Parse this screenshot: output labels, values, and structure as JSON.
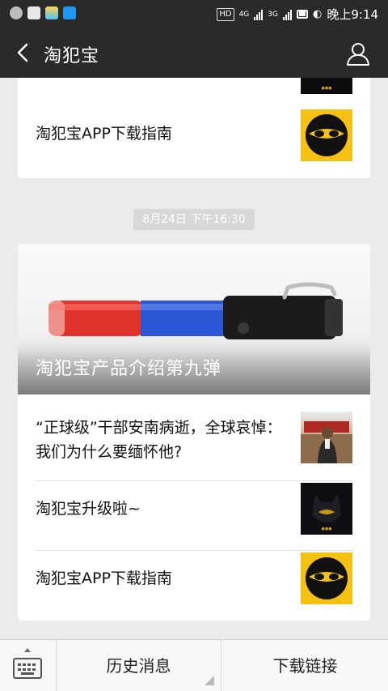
{
  "status_bar": {
    "time": "晚上9:14",
    "hd": "HD",
    "net1": "4G",
    "net2": "3G"
  },
  "header": {
    "title": "淘犯宝"
  },
  "card1": {
    "items": [
      {
        "title": "淘犯宝APP下载指南",
        "thumb": "ninja-mask-logo"
      }
    ]
  },
  "timestamp": "8月24日 下午16:30",
  "card2": {
    "cover_title": "淘犯宝产品介绍第九弹",
    "items": [
      {
        "title": "“正球级”干部安南病逝，全球哀悼：我们为什么要缅怀他?",
        "thumb": "person-photo"
      },
      {
        "title": "淘犯宝升级啦~",
        "thumb": "dark-mask-logo"
      },
      {
        "title": "淘犯宝APP下载指南",
        "thumb": "ninja-mask-logo"
      }
    ]
  },
  "bottom_menu": {
    "history_label": "历史消息",
    "download_label": "下载链接"
  },
  "colors": {
    "header_bg": "#2a2a2a",
    "background": "#ebebeb",
    "logo_yellow": "#f5c214"
  }
}
